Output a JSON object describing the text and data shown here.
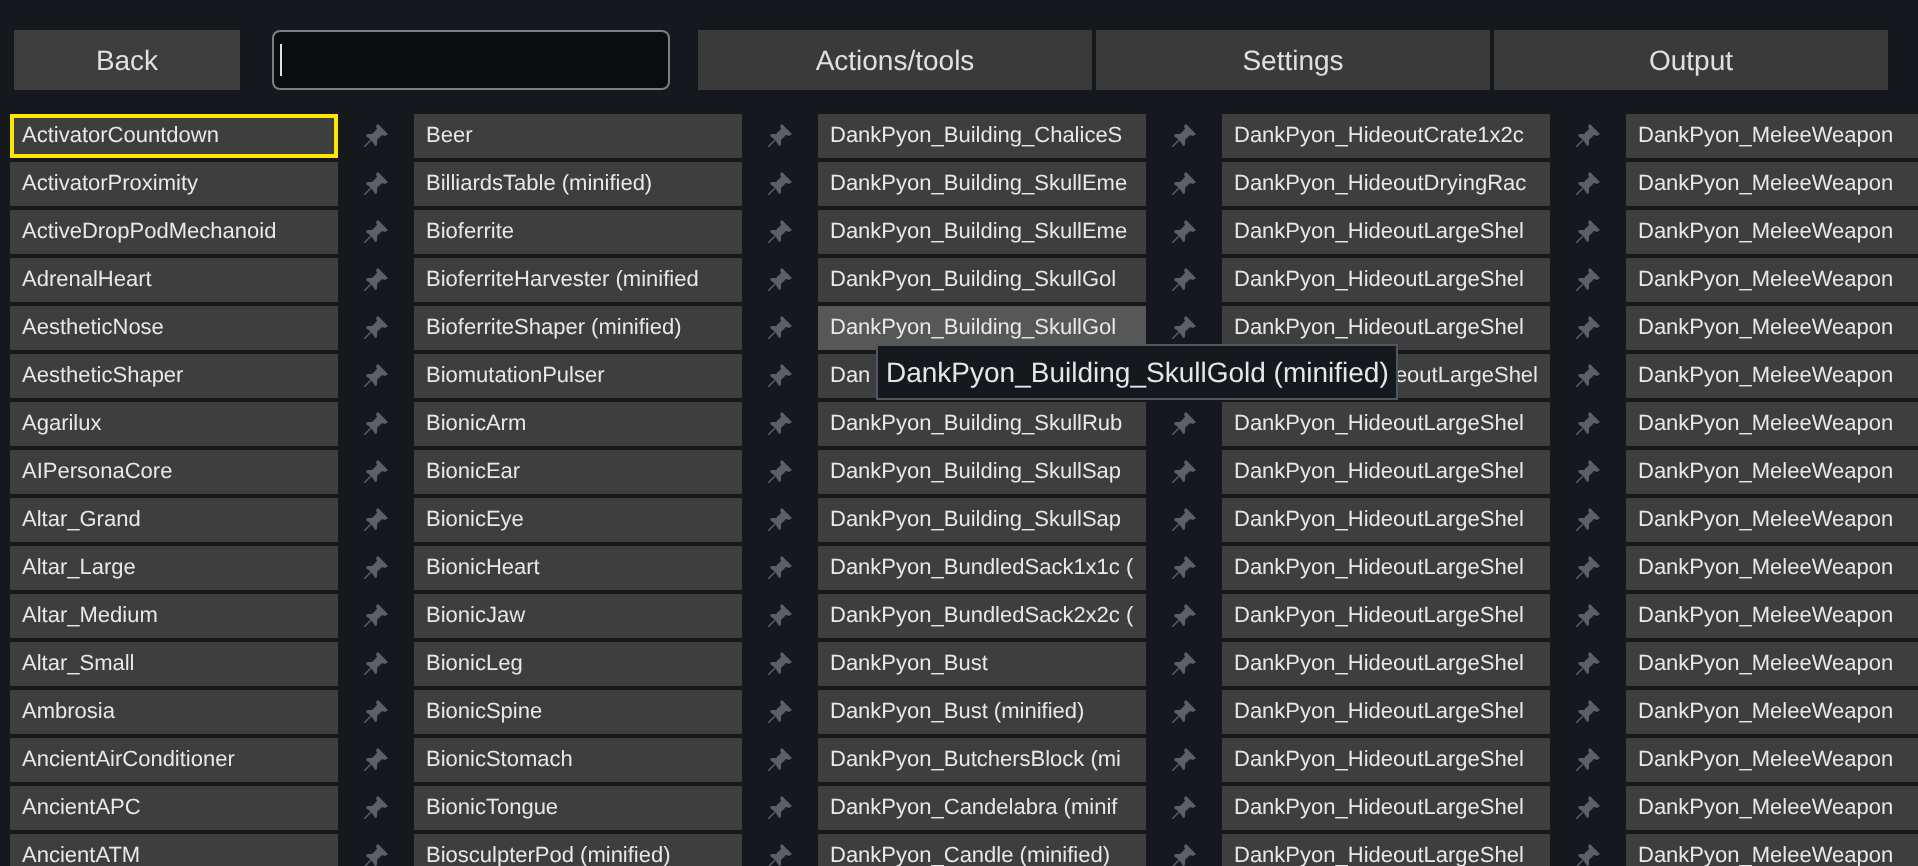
{
  "toolbar": {
    "back": {
      "label": "Back"
    },
    "search": {
      "focused": true
    },
    "tabs": [
      {
        "label": "Actions/tools",
        "selected": false
      },
      {
        "label": "Settings",
        "selected": false
      },
      {
        "label": "Output",
        "selected": false
      }
    ]
  },
  "columns": [
    {
      "cells": [
        {
          "label": "ActivatorCountdown",
          "selected": true,
          "hovered": false,
          "pin": true,
          "kind": "plain"
        },
        {
          "label": "ActivatorProximity",
          "selected": false,
          "hovered": false,
          "pin": true,
          "kind": "plain"
        },
        {
          "label": "ActiveDropPodMechanoid",
          "selected": false,
          "hovered": false,
          "pin": true,
          "kind": "plain"
        },
        {
          "label": "AdrenalHeart",
          "selected": false,
          "hovered": false,
          "pin": true,
          "kind": "plain"
        },
        {
          "label": "AestheticNose",
          "selected": false,
          "hovered": false,
          "pin": true,
          "kind": "plain"
        },
        {
          "label": "AestheticShaper",
          "selected": false,
          "hovered": false,
          "pin": true,
          "kind": "plain"
        },
        {
          "label": "Agarilux",
          "selected": false,
          "hovered": false,
          "pin": true,
          "kind": "plain"
        },
        {
          "label": "AIPersonaCore",
          "selected": false,
          "hovered": false,
          "pin": true,
          "kind": "plain"
        },
        {
          "label": "Altar_Grand",
          "selected": false,
          "hovered": false,
          "pin": true,
          "kind": "plain"
        },
        {
          "label": "Altar_Large",
          "selected": false,
          "hovered": false,
          "pin": true,
          "kind": "plain"
        },
        {
          "label": "Altar_Medium",
          "selected": false,
          "hovered": false,
          "pin": true,
          "kind": "plain"
        },
        {
          "label": "Altar_Small",
          "selected": false,
          "hovered": false,
          "pin": true,
          "kind": "plain"
        },
        {
          "label": "Ambrosia",
          "selected": false,
          "hovered": false,
          "pin": true,
          "kind": "plain"
        },
        {
          "label": "AncientAirConditioner",
          "selected": false,
          "hovered": false,
          "pin": true,
          "kind": "plain"
        },
        {
          "label": "AncientAPC",
          "selected": false,
          "hovered": false,
          "pin": true,
          "kind": "plain"
        },
        {
          "label": "AncientATM",
          "selected": false,
          "hovered": false,
          "pin": true,
          "kind": "plain"
        }
      ]
    },
    {
      "cells": [
        {
          "label": "Beer",
          "selected": false,
          "hovered": false,
          "pin": true,
          "kind": "plain"
        },
        {
          "label": "BilliardsTable (minified)",
          "selected": false,
          "hovered": false,
          "pin": true,
          "kind": "plain"
        },
        {
          "label": "Bioferrite",
          "selected": false,
          "hovered": false,
          "pin": true,
          "kind": "plain"
        },
        {
          "label": "BioferriteHarvester (minified",
          "selected": false,
          "hovered": false,
          "pin": true,
          "kind": "plain"
        },
        {
          "label": "BioferriteShaper (minified)",
          "selected": false,
          "hovered": false,
          "pin": true,
          "kind": "plain"
        },
        {
          "label": "BiomutationPulser",
          "selected": false,
          "hovered": false,
          "pin": true,
          "kind": "plain"
        },
        {
          "label": "BionicArm",
          "selected": false,
          "hovered": false,
          "pin": true,
          "kind": "plain"
        },
        {
          "label": "BionicEar",
          "selected": false,
          "hovered": false,
          "pin": true,
          "kind": "plain"
        },
        {
          "label": "BionicEye",
          "selected": false,
          "hovered": false,
          "pin": true,
          "kind": "plain"
        },
        {
          "label": "BionicHeart",
          "selected": false,
          "hovered": false,
          "pin": true,
          "kind": "plain"
        },
        {
          "label": "BionicJaw",
          "selected": false,
          "hovered": false,
          "pin": true,
          "kind": "plain"
        },
        {
          "label": "BionicLeg",
          "selected": false,
          "hovered": false,
          "pin": true,
          "kind": "plain"
        },
        {
          "label": "BionicSpine",
          "selected": false,
          "hovered": false,
          "pin": true,
          "kind": "plain"
        },
        {
          "label": "BionicStomach",
          "selected": false,
          "hovered": false,
          "pin": true,
          "kind": "plain"
        },
        {
          "label": "BionicTongue",
          "selected": false,
          "hovered": false,
          "pin": true,
          "kind": "plain"
        },
        {
          "label": "BiosculpterPod (minified)",
          "selected": false,
          "hovered": false,
          "pin": true,
          "kind": "plain"
        }
      ]
    },
    {
      "cells": [
        {
          "label": "DankPyon_Building_ChaliceS",
          "selected": false,
          "hovered": false,
          "pin": true,
          "kind": "plain"
        },
        {
          "label": "DankPyon_Building_SkullEme",
          "selected": false,
          "hovered": false,
          "pin": true,
          "kind": "plain"
        },
        {
          "label": "DankPyon_Building_SkullEme",
          "selected": false,
          "hovered": false,
          "pin": true,
          "kind": "plain"
        },
        {
          "label": "DankPyon_Building_SkullGol",
          "selected": false,
          "hovered": false,
          "pin": true,
          "kind": "plain"
        },
        {
          "label": "DankPyon_Building_SkullGol",
          "selected": false,
          "hovered": true,
          "pin": true,
          "kind": "plain"
        },
        {
          "label": "Dan",
          "selected": false,
          "hovered": false,
          "pin": false,
          "kind": "plain"
        },
        {
          "label": "DankPyon_Building_SkullRub",
          "selected": false,
          "hovered": false,
          "pin": true,
          "kind": "plain"
        },
        {
          "label": "DankPyon_Building_SkullSap",
          "selected": false,
          "hovered": false,
          "pin": true,
          "kind": "plain"
        },
        {
          "label": "DankPyon_Building_SkullSap",
          "selected": false,
          "hovered": false,
          "pin": true,
          "kind": "plain"
        },
        {
          "label": "DankPyon_BundledSack1x1c (",
          "selected": false,
          "hovered": false,
          "pin": true,
          "kind": "plain"
        },
        {
          "label": "DankPyon_BundledSack2x2c (",
          "selected": false,
          "hovered": false,
          "pin": true,
          "kind": "plain"
        },
        {
          "label": "DankPyon_Bust",
          "selected": false,
          "hovered": false,
          "pin": true,
          "kind": "plain"
        },
        {
          "label": "DankPyon_Bust (minified)",
          "selected": false,
          "hovered": false,
          "pin": true,
          "kind": "plain"
        },
        {
          "label": "DankPyon_ButchersBlock (mi",
          "selected": false,
          "hovered": false,
          "pin": true,
          "kind": "plain"
        },
        {
          "label": "DankPyon_Candelabra (minif",
          "selected": false,
          "hovered": false,
          "pin": true,
          "kind": "plain"
        },
        {
          "label": "DankPyon_Candle (minified)",
          "selected": false,
          "hovered": false,
          "pin": true,
          "kind": "plain"
        }
      ]
    },
    {
      "cells": [
        {
          "label": "DankPyon_HideoutCrate1x2c",
          "selected": false,
          "hovered": false,
          "pin": true,
          "kind": "plain"
        },
        {
          "label": "DankPyon_HideoutDryingRac",
          "selected": false,
          "hovered": false,
          "pin": true,
          "kind": "plain"
        },
        {
          "label": "DankPyon_HideoutLargeShel",
          "selected": false,
          "hovered": false,
          "pin": true,
          "kind": "plain"
        },
        {
          "label": "DankPyon_HideoutLargeShel",
          "selected": false,
          "hovered": false,
          "pin": true,
          "kind": "plain"
        },
        {
          "label": "DankPyon_HideoutLargeShel",
          "selected": false,
          "hovered": false,
          "pin": true,
          "kind": "plain"
        },
        {
          "label": "eoutLargeShel",
          "selected": false,
          "hovered": false,
          "pin": true,
          "kind": "covered"
        },
        {
          "label": "DankPyon_HideoutLargeShel",
          "selected": false,
          "hovered": false,
          "pin": true,
          "kind": "plain"
        },
        {
          "label": "DankPyon_HideoutLargeShel",
          "selected": false,
          "hovered": false,
          "pin": true,
          "kind": "plain"
        },
        {
          "label": "DankPyon_HideoutLargeShel",
          "selected": false,
          "hovered": false,
          "pin": true,
          "kind": "plain"
        },
        {
          "label": "DankPyon_HideoutLargeShel",
          "selected": false,
          "hovered": false,
          "pin": true,
          "kind": "plain"
        },
        {
          "label": "DankPyon_HideoutLargeShel",
          "selected": false,
          "hovered": false,
          "pin": true,
          "kind": "plain"
        },
        {
          "label": "DankPyon_HideoutLargeShel",
          "selected": false,
          "hovered": false,
          "pin": true,
          "kind": "plain"
        },
        {
          "label": "DankPyon_HideoutLargeShel",
          "selected": false,
          "hovered": false,
          "pin": true,
          "kind": "plain"
        },
        {
          "label": "DankPyon_HideoutLargeShel",
          "selected": false,
          "hovered": false,
          "pin": true,
          "kind": "plain"
        },
        {
          "label": "DankPyon_HideoutLargeShel",
          "selected": false,
          "hovered": false,
          "pin": true,
          "kind": "plain"
        },
        {
          "label": "DankPyon_HideoutLargeShel",
          "selected": false,
          "hovered": false,
          "pin": true,
          "kind": "plain"
        }
      ]
    },
    {
      "cells": [
        {
          "label": "DankPyon_MeleeWeapon",
          "selected": false,
          "hovered": false,
          "pin": false,
          "kind": "plain"
        },
        {
          "label": "DankPyon_MeleeWeapon",
          "selected": false,
          "hovered": false,
          "pin": false,
          "kind": "plain"
        },
        {
          "label": "DankPyon_MeleeWeapon",
          "selected": false,
          "hovered": false,
          "pin": false,
          "kind": "plain"
        },
        {
          "label": "DankPyon_MeleeWeapon",
          "selected": false,
          "hovered": false,
          "pin": false,
          "kind": "plain"
        },
        {
          "label": "DankPyon_MeleeWeapon",
          "selected": false,
          "hovered": false,
          "pin": false,
          "kind": "plain"
        },
        {
          "label": "DankPyon_MeleeWeapon",
          "selected": false,
          "hovered": false,
          "pin": false,
          "kind": "plain"
        },
        {
          "label": "DankPyon_MeleeWeapon",
          "selected": false,
          "hovered": false,
          "pin": false,
          "kind": "plain"
        },
        {
          "label": "DankPyon_MeleeWeapon",
          "selected": false,
          "hovered": false,
          "pin": false,
          "kind": "plain"
        },
        {
          "label": "DankPyon_MeleeWeapon",
          "selected": false,
          "hovered": false,
          "pin": false,
          "kind": "plain"
        },
        {
          "label": "DankPyon_MeleeWeapon",
          "selected": false,
          "hovered": false,
          "pin": false,
          "kind": "plain"
        },
        {
          "label": "DankPyon_MeleeWeapon",
          "selected": false,
          "hovered": false,
          "pin": false,
          "kind": "plain"
        },
        {
          "label": "DankPyon_MeleeWeapon",
          "selected": false,
          "hovered": false,
          "pin": false,
          "kind": "plain"
        },
        {
          "label": "DankPyon_MeleeWeapon",
          "selected": false,
          "hovered": false,
          "pin": false,
          "kind": "plain"
        },
        {
          "label": "DankPyon_MeleeWeapon",
          "selected": false,
          "hovered": false,
          "pin": false,
          "kind": "plain"
        },
        {
          "label": "DankPyon_MeleeWeapon",
          "selected": false,
          "hovered": false,
          "pin": false,
          "kind": "plain"
        },
        {
          "label": "DankPyon_MeleeWeapon",
          "selected": false,
          "hovered": false,
          "pin": false,
          "kind": "plain"
        }
      ]
    }
  ],
  "tooltip": {
    "text": "DankPyon_Building_SkullGold (minified)"
  }
}
